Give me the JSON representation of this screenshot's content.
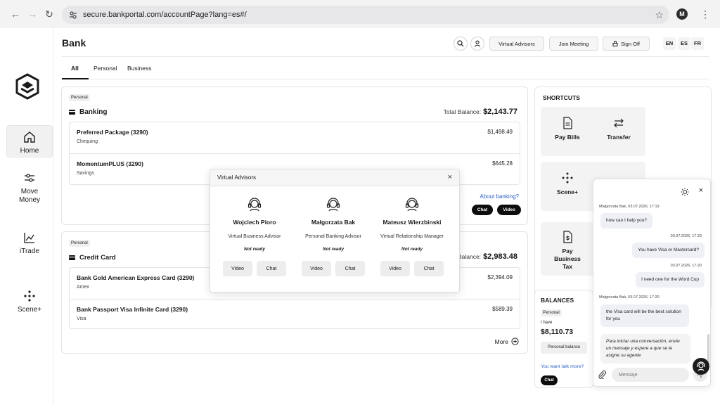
{
  "browser": {
    "url": "secure.bankportal.com/accountPage?lang=es#/",
    "profile_initial": "M"
  },
  "sidebar": {
    "items": [
      {
        "label": "Home"
      },
      {
        "label": "Move Money"
      },
      {
        "label": "iTrade"
      },
      {
        "label": "Scene+"
      }
    ]
  },
  "header": {
    "title": "Bank",
    "virtual_advisors": "Virtual Advisors",
    "join_meeting": "Join Meeting",
    "sign_off": "Sign Off",
    "languages": [
      "EN",
      "ES",
      "FR"
    ]
  },
  "tabs": [
    "All",
    "Personal",
    "Business"
  ],
  "banking": {
    "chip": "Personal",
    "title": "Banking",
    "total_label": "Total Balance:",
    "total_value": "$2,143.77",
    "accounts": [
      {
        "name": "Preferred Package (3290)",
        "type": "Chequing",
        "amount": "$1,498.49"
      },
      {
        "name": "MomentumPLUS (3290)",
        "type": "Savings",
        "amount": "$645.28"
      }
    ],
    "about_link": "About banking?",
    "chat": "Chat",
    "video": "Video"
  },
  "credit": {
    "chip": "Personal",
    "title": "Credit Card",
    "total_label": "Balance:",
    "total_value": "$2,983.48",
    "accounts": [
      {
        "name": "Bank Gold American Express Card (3290)",
        "type": "Amex",
        "amount": "$2,394.09"
      },
      {
        "name": "Bank Passport Visa Infinite Card (3290)",
        "type": "Visa",
        "amount": "$589.39"
      }
    ],
    "more": "More"
  },
  "advisors_modal": {
    "title": "Virtual Advisors",
    "advisors": [
      {
        "name": "Wojciech Pioro",
        "role": "Virtual Business Advisor",
        "status": "Not ready"
      },
      {
        "name": "Małgorzata Bak",
        "role": "Personal Banking Advisor",
        "status": "Not ready"
      },
      {
        "name": "Mateusz Wierzbinski",
        "role": "Virtual Relationship Manager",
        "status": "Not ready"
      }
    ],
    "video": "Video",
    "chat": "Chat"
  },
  "shortcuts": {
    "title": "SHORTCUTS",
    "items": [
      "Pay Bills",
      "Transfer",
      "Scene+",
      "Pay Business Tax"
    ]
  },
  "balances": {
    "title": "BALANCES",
    "chip": "Personal",
    "have_label": "I have",
    "amount": "$8,110.73",
    "button": "Personal balance",
    "talk_link": "You want talk more?",
    "chat": "Chat"
  },
  "chat": {
    "messages": [
      {
        "from": "agent",
        "meta": "Małgorzata Bak, 03.07.2026, 17:19",
        "text": "how can I help you?"
      },
      {
        "from": "user",
        "meta": "03.07.2026, 17:20",
        "text": "You have Visa or Mastercard?"
      },
      {
        "from": "user",
        "meta": "03.07.2026, 17:20",
        "text": "I need one for the Word Cup"
      },
      {
        "from": "agent",
        "meta": "Małgorzata Bak, 03.07.2026, 17:20",
        "text": "the Visa card will be the best solution for you"
      },
      {
        "from": "system",
        "meta": "",
        "text": "Para iniciar una conversación, envíe un mensaje y espere a que se le asigne su agente"
      }
    ],
    "placeholder": "Mensaje"
  }
}
